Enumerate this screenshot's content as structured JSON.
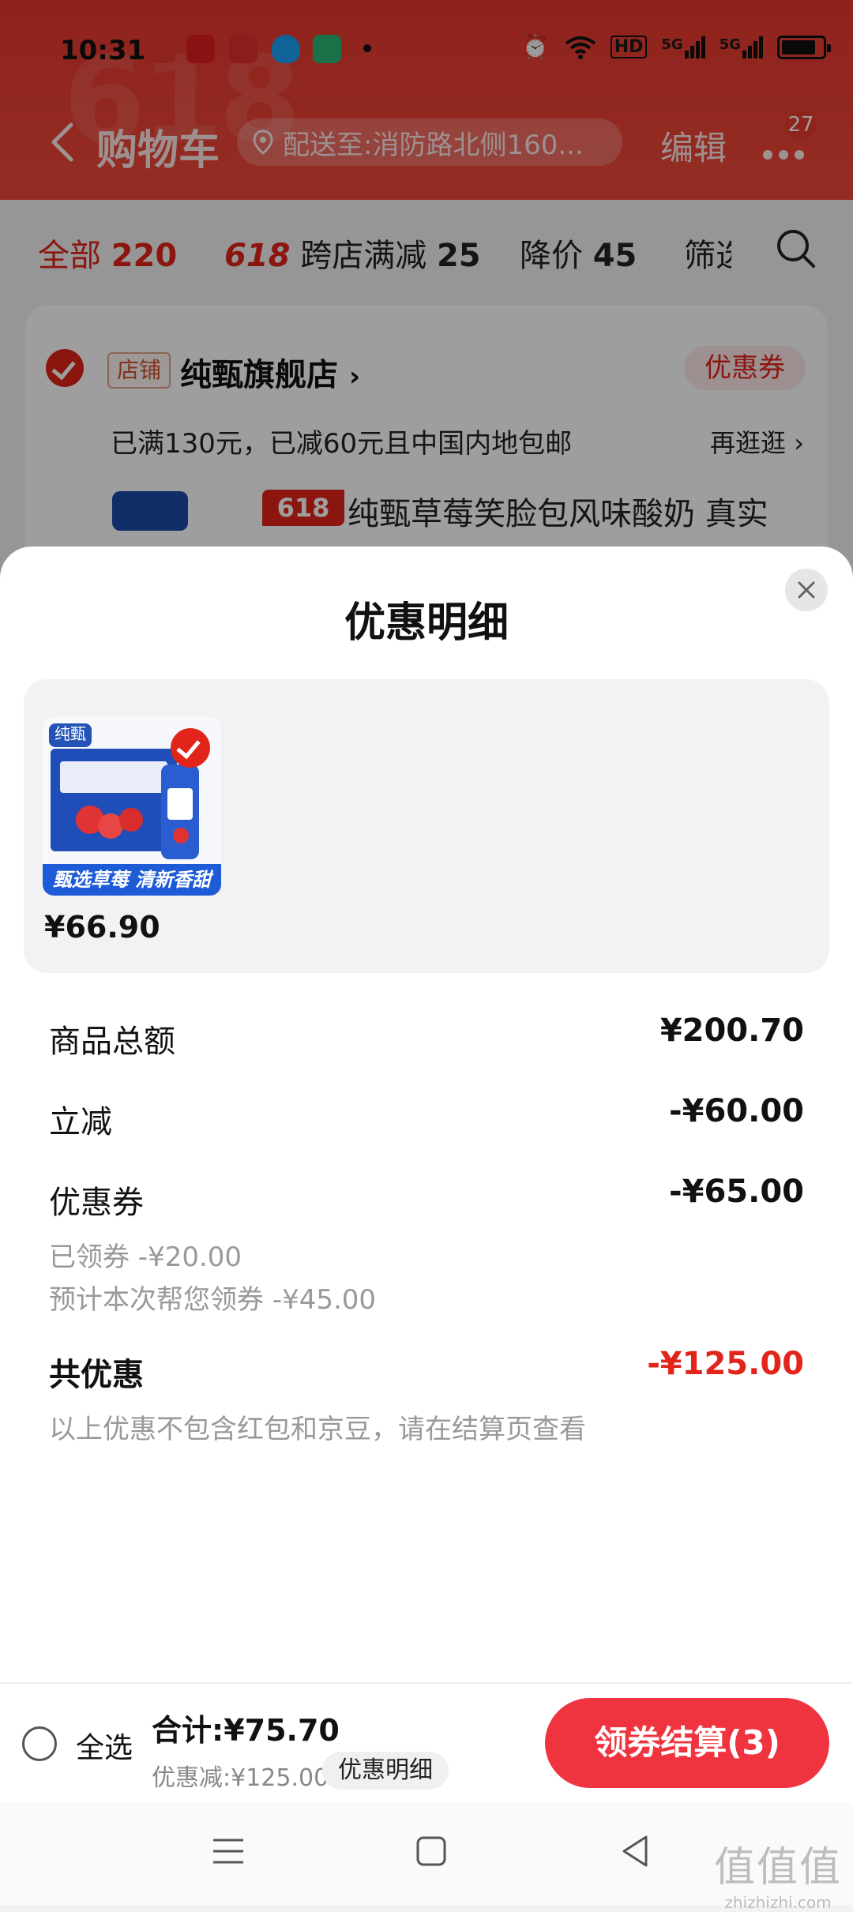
{
  "status_bar": {
    "time": "10:31",
    "app_icons": [
      {
        "name": "618-app-icon",
        "color": "#e63b2e"
      },
      {
        "name": "tmall-app-icon",
        "color": "#e02020"
      },
      {
        "name": "yunshanfu-app-icon",
        "color": "#e02f2f"
      },
      {
        "name": "qq-app-icon",
        "color": "#1ba0f2"
      },
      {
        "name": "360-app-icon",
        "color": "#2bb673"
      }
    ],
    "signal_labels": [
      "HD",
      "5G",
      "5G"
    ]
  },
  "header": {
    "decor_text": "618",
    "title": "购物车",
    "location": "配送至:消防路北侧160...",
    "edit": "编辑",
    "more_badge": "27"
  },
  "filter_tabs": [
    {
      "label": "全部",
      "count": "220",
      "active": true
    },
    {
      "badge": "618",
      "label": "跨店满减",
      "count": "25"
    },
    {
      "label": "降价",
      "count": "45"
    },
    {
      "label": "筛选"
    }
  ],
  "store": {
    "tag": "店铺",
    "name": "纯甄旗舰店",
    "coupon_button": "优惠券",
    "promo": "已满130元，已减60元且中国内地包邮",
    "promo_more": "再逛逛",
    "product_badge": "618",
    "product_title": "纯甄草莓笑脸包风味酸奶 真实"
  },
  "sheet": {
    "title": "优惠明细",
    "product": {
      "brand": "纯甄",
      "banner": "甄选草莓 清新香甜",
      "price": "¥66.90"
    },
    "rows": [
      {
        "label": "商品总额",
        "value": "¥200.70"
      },
      {
        "label": "立减",
        "value": "-¥60.00"
      },
      {
        "label": "优惠券",
        "value": "-¥65.00"
      }
    ],
    "coupon_details": [
      "已领券 -¥20.00",
      "预计本次帮您领券 -¥45.00"
    ],
    "total_label": "共优惠",
    "total_value": "-¥125.00",
    "note": "以上优惠不包含红包和京豆，请在结算页查看"
  },
  "bottom_bar": {
    "select_all": "全选",
    "total": "合计:¥75.70",
    "discount": "优惠减:¥125.00",
    "detail_button": "优惠明细",
    "checkout": "领券结算(3)"
  },
  "watermark": {
    "big": "值值值",
    "small": "zhizhizhi.com"
  },
  "colors": {
    "brand_red": "#e1251b",
    "checkout_red": "#f0343f",
    "header_red": "#e8372e"
  }
}
